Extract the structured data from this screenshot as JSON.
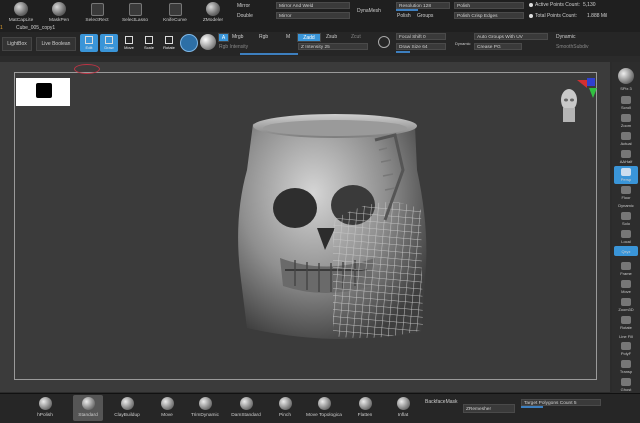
{
  "top_tools": [
    {
      "label": "MatCapLite"
    },
    {
      "label": "MaskPen"
    },
    {
      "label": "SelectRect"
    },
    {
      "label": "SelectLasso"
    },
    {
      "label": "KnifeCurve"
    },
    {
      "label": "ZModeler"
    }
  ],
  "subtool": {
    "number": "1",
    "name": "Cube_005_copy1"
  },
  "mirror": {
    "l1": "Mirror",
    "l2": "Double",
    "f1": "Mirror And Weld",
    "f2": "Mirror",
    "dynamesh": "DynaMesh"
  },
  "resolution": {
    "label": "Resolution",
    "value": "128"
  },
  "polish": {
    "p1": "Polish",
    "p2": "Groups",
    "p3": "Polish",
    "p4": "Polish Crisp Edges"
  },
  "stats": {
    "active_label": "Active Points Count:",
    "active_value": "5,130",
    "total_label": "Total Points Count:",
    "total_value": "1.888 Mil"
  },
  "row2": {
    "lightbox": "LightBox",
    "live_boolean": "Live Boolean",
    "edit": "Edit",
    "draw": "Draw",
    "move": "Move",
    "scale": "Scale",
    "rotate": "Rotate",
    "a": "A",
    "mrgb": "Mrgb",
    "rgb": "Rgb",
    "m": "M",
    "zadd": "Zadd",
    "zsub": "Zsub",
    "zcut": "Zcut",
    "rgb_intensity": "Rgb Intensity",
    "z_intensity_label": "Z Intensity",
    "z_intensity_value": "25",
    "focal_label": "Focal Shift",
    "focal_value": "0",
    "draw_size_label": "Draw Size",
    "draw_size_value": "64",
    "dynamic_small": "Dynamic",
    "auto_groups": "Auto Groups With UV",
    "crease_pg": "Crease PG",
    "dynamic": "Dynamic",
    "smooth": "SmoothSubdiv"
  },
  "right_bar": [
    {
      "label": "SPix 3"
    },
    {
      "label": "Scroll"
    },
    {
      "label": "Zoom"
    },
    {
      "label": "Actual"
    },
    {
      "label": "AAHalf"
    },
    {
      "label": "Persp"
    },
    {
      "label": "Floor"
    },
    {
      "label": "Dynamic"
    },
    {
      "label": "Solo"
    },
    {
      "label": "Local"
    },
    {
      "label": "Qxyz"
    },
    {
      "label": "Frame"
    },
    {
      "label": "Move"
    },
    {
      "label": "Zoom3D"
    },
    {
      "label": "Rotate"
    },
    {
      "label": "Line Fill"
    },
    {
      "label": "PolyF"
    },
    {
      "label": "Transp"
    },
    {
      "label": "Ghost"
    },
    {
      "label": "Xpose"
    }
  ],
  "bottom_brushes": [
    {
      "label": "hPolish"
    },
    {
      "label": "Standard"
    },
    {
      "label": "ClayBuildup"
    },
    {
      "label": "Move"
    },
    {
      "label": "TrimDynamic"
    },
    {
      "label": "DamStandard"
    },
    {
      "label": "Pinch"
    },
    {
      "label": "Move Topologica"
    },
    {
      "label": "Flatten"
    },
    {
      "label": "Inflat"
    }
  ],
  "bottom_right": {
    "backface": "BackfaceMask",
    "zremesher": "ZRemesher",
    "target_label": "Target Polygons Count",
    "target_value": "5"
  },
  "colors": {
    "accent": "#3a95d8",
    "slider": "#3d7fbf"
  }
}
